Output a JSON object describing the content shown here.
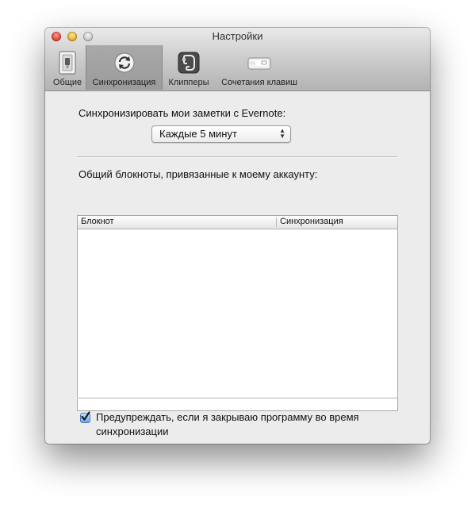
{
  "window": {
    "title": "Настройки"
  },
  "toolbar": {
    "items": [
      {
        "label": "Общие",
        "icon": "general-switch-icon",
        "selected": false
      },
      {
        "label": "Синхронизация",
        "icon": "sync-icon",
        "selected": true
      },
      {
        "label": "Клипперы",
        "icon": "evernote-elephant-icon",
        "selected": false
      },
      {
        "label": "Сочетания клавиш",
        "icon": "keyboard-key-icon",
        "selected": false
      }
    ]
  },
  "sync": {
    "label": "Синхронизировать мои заметки с Evernote:",
    "interval_value": "Каждые 5 минут"
  },
  "shared": {
    "label": "Общий блокноты, привязанные к моему аккаунту:",
    "columns": [
      "Блокнот",
      "Синхронизация"
    ],
    "rows": []
  },
  "warn": {
    "checked": true,
    "text": "Предупреждать, если я закрываю программу во время синхронизации"
  }
}
